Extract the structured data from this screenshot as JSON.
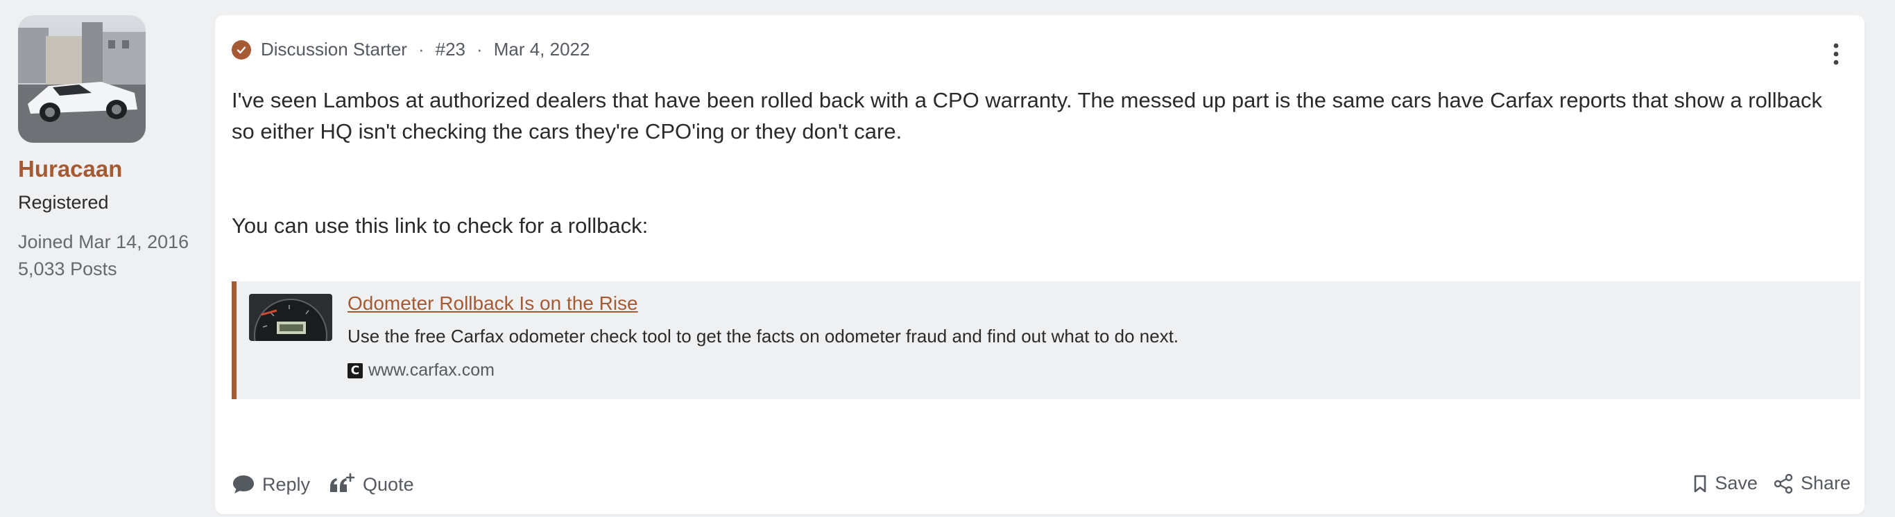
{
  "user": {
    "name": "Huracaan",
    "title": "Registered",
    "joined": "Joined Mar 14, 2016",
    "posts": "5,033 Posts"
  },
  "post": {
    "badge": "Discussion Starter",
    "number": "#23",
    "date": "Mar 4, 2022",
    "separator": "·",
    "body": [
      "I've seen Lambos at authorized dealers that have been rolled back with a CPO warranty. The messed up part is the same cars have Carfax reports that show a rollback so either HQ isn't checking the cars they're CPO'ing or they don't care.",
      "You can use this link to check for a rollback:"
    ],
    "link_preview": {
      "title": "Odometer Rollback Is on the Rise",
      "description": "Use the free Carfax odometer check tool to get the facts on odometer fraud and find out what to do next.",
      "favicon_letter": "C",
      "domain": "www.carfax.com"
    }
  },
  "actions": {
    "reply": "Reply",
    "quote": "Quote",
    "save": "Save",
    "share": "Share"
  },
  "icons": {
    "menu": "kebab-menu-icon",
    "badge": "check-badge-icon",
    "reply": "speech-bubble-icon",
    "quote": "quote-plus-icon",
    "save": "bookmark-icon",
    "share": "share-icon"
  },
  "colors": {
    "accent": "#a65a33",
    "background": "#eff0f2",
    "card": "#ffffff",
    "muted_text": "#555a60"
  }
}
